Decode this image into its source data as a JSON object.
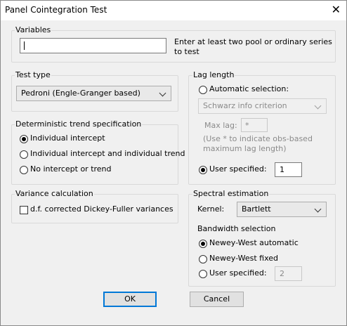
{
  "window": {
    "title": "Panel Cointegration Test"
  },
  "variables": {
    "label": "Variables",
    "value": "",
    "hint_line1": "Enter at least two pool or ordinary series",
    "hint_line2": "to test"
  },
  "test_type": {
    "label": "Test type",
    "selected": "Pedroni (Engle-Granger based)"
  },
  "deterministic": {
    "label": "Deterministic trend specification",
    "options": [
      "Individual intercept",
      "Individual intercept and individual trend",
      "No intercept or trend"
    ],
    "selected_index": 0
  },
  "variance": {
    "label": "Variance calculation",
    "checkbox_label": "d.f. corrected Dickey-Fuller variances",
    "checked": false
  },
  "lag_length": {
    "label": "Lag length",
    "automatic_label": "Automatic selection:",
    "criterion": "Schwarz info criterion",
    "max_lag_label": "Max lag:",
    "max_lag_value": "*",
    "note_line1": "(Use * to indicate obs-based",
    "note_line2": "maximum lag length)",
    "user_label": "User specified:",
    "user_value": "1",
    "mode": "user"
  },
  "spectral": {
    "label": "Spectral estimation",
    "kernel_label": "Kernel:",
    "kernel_value": "Bartlett",
    "bandwidth_label": "Bandwidth selection",
    "options": [
      "Newey-West automatic",
      "Newey-West fixed",
      "User specified:"
    ],
    "selected_index": 0,
    "user_value": "2"
  },
  "buttons": {
    "ok": "OK",
    "cancel": "Cancel"
  },
  "colors": {
    "default_button_border": "#0078d7",
    "disabled_text": "#8a8a8a"
  }
}
